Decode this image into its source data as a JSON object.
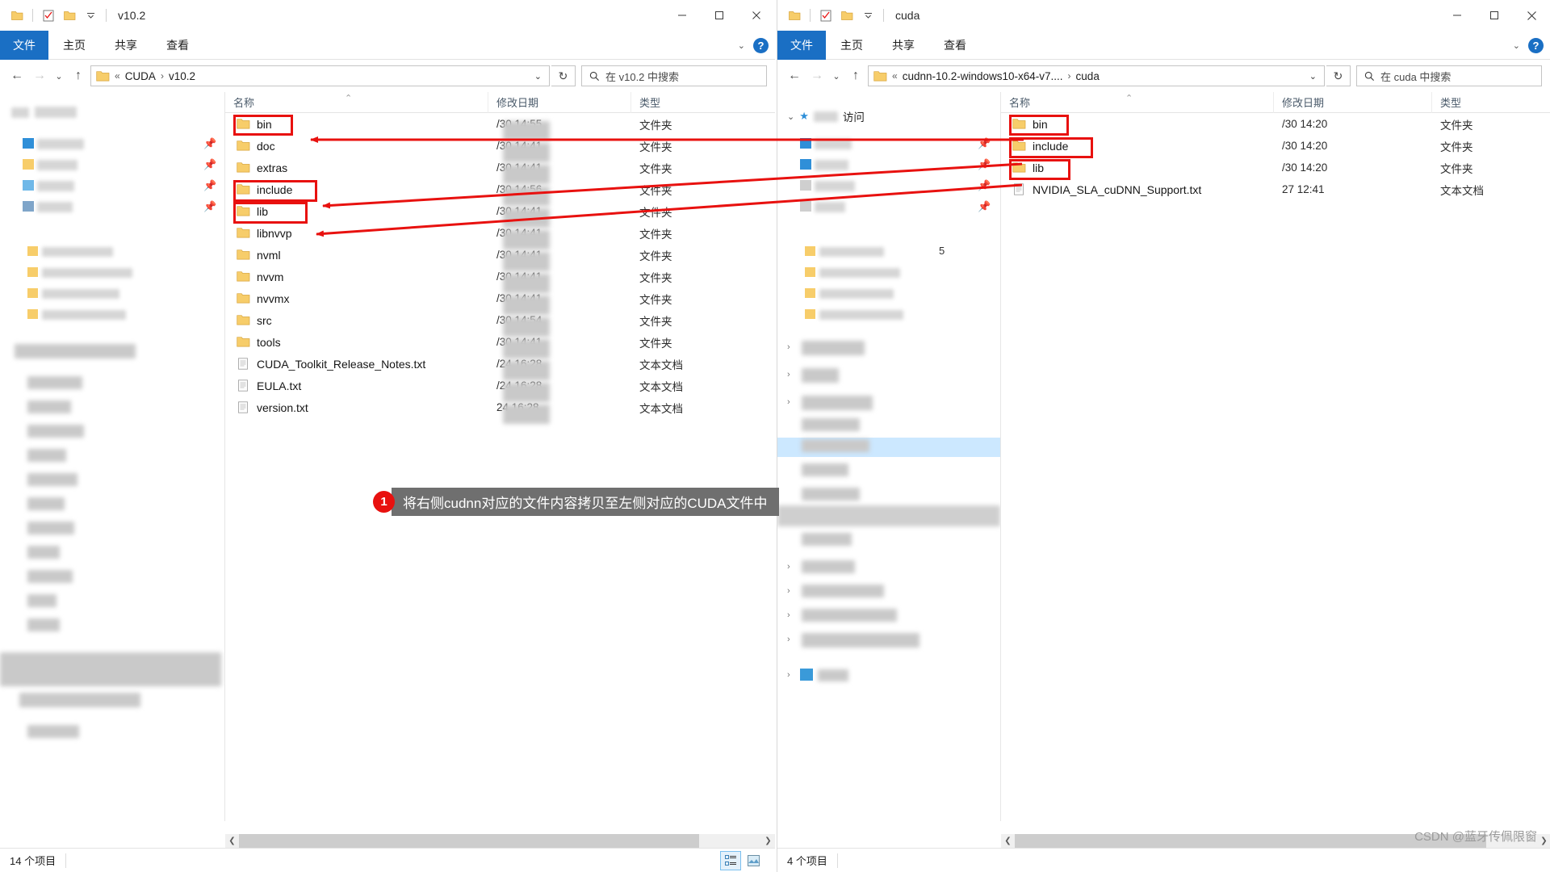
{
  "left_window": {
    "title": "v10.2",
    "qat_icons": [
      "folder-icon",
      "properties-icon",
      "new-folder-icon",
      "dropdown-caret-icon"
    ],
    "window_controls": [
      "minimize-icon",
      "maximize-icon",
      "close-icon"
    ],
    "ribbon": {
      "file_label": "文件",
      "tabs": [
        "主页",
        "共享",
        "查看"
      ],
      "help_label": "?"
    },
    "address": {
      "crumbs": [
        "«",
        "CUDA",
        "v10.2"
      ],
      "separator": "›",
      "refresh_label": "↻"
    },
    "search": {
      "placeholder": "在 v10.2 中搜索"
    },
    "columns": [
      "名称",
      "修改日期",
      "类型"
    ],
    "rows": [
      {
        "name": "bin",
        "icon": "folder-icon",
        "date": "/30 14:55",
        "type": "文件夹",
        "highlight": true
      },
      {
        "name": "doc",
        "icon": "folder-icon",
        "date": "/30 14:41",
        "type": "文件夹",
        "highlight": false
      },
      {
        "name": "extras",
        "icon": "folder-icon",
        "date": "/30 14:41",
        "type": "文件夹",
        "highlight": false
      },
      {
        "name": "include",
        "icon": "folder-icon",
        "date": "/30 14:56",
        "type": "文件夹",
        "highlight": true
      },
      {
        "name": "lib",
        "icon": "folder-icon",
        "date": "/30 14:41",
        "type": "文件夹",
        "highlight": true
      },
      {
        "name": "libnvvp",
        "icon": "folder-icon",
        "date": "/30 14:41",
        "type": "文件夹",
        "highlight": false
      },
      {
        "name": "nvml",
        "icon": "folder-icon",
        "date": "/30 14:41",
        "type": "文件夹",
        "highlight": false
      },
      {
        "name": "nvvm",
        "icon": "folder-icon",
        "date": "/30 14:41",
        "type": "文件夹",
        "highlight": false
      },
      {
        "name": "nvvmx",
        "icon": "folder-icon",
        "date": "/30 14:41",
        "type": "文件夹",
        "highlight": false
      },
      {
        "name": "src",
        "icon": "folder-icon",
        "date": "/30 14:54",
        "type": "文件夹",
        "highlight": false
      },
      {
        "name": "tools",
        "icon": "folder-icon",
        "date": "/30 14:41",
        "type": "文件夹",
        "highlight": false
      },
      {
        "name": "CUDA_Toolkit_Release_Notes.txt",
        "icon": "text-file-icon",
        "date": "/24 16:28",
        "type": "文本文档",
        "highlight": false
      },
      {
        "name": "EULA.txt",
        "icon": "text-file-icon",
        "date": "/24 16:28",
        "type": "文本文档",
        "highlight": false
      },
      {
        "name": "version.txt",
        "icon": "text-file-icon",
        "date": "24 16:28",
        "type": "文本文档",
        "highlight": false
      }
    ],
    "status": {
      "item_count": "14 个项目"
    }
  },
  "right_window": {
    "title": "cuda",
    "ribbon": {
      "file_label": "文件",
      "tabs": [
        "主页",
        "共享",
        "查看"
      ],
      "help_label": "?"
    },
    "address": {
      "crumbs": [
        "«",
        "cudnn-10.2-windows10-x64-v7....",
        "cuda"
      ],
      "separator": "›",
      "refresh_label": "↻"
    },
    "search": {
      "placeholder": "在 cuda 中搜索"
    },
    "nav_header": "访问",
    "columns": [
      "名称",
      "修改日期",
      "类型"
    ],
    "rows": [
      {
        "name": "bin",
        "icon": "folder-icon",
        "date": "/30 14:20",
        "type": "文件夹",
        "highlight": true
      },
      {
        "name": "include",
        "icon": "folder-icon",
        "date": "/30 14:20",
        "type": "文件夹",
        "highlight": true
      },
      {
        "name": "lib",
        "icon": "folder-icon",
        "date": "/30 14:20",
        "type": "文件夹",
        "highlight": true
      },
      {
        "name": "NVIDIA_SLA_cuDNN_Support.txt",
        "icon": "text-file-icon",
        "date": "27 12:41",
        "type": "文本文档",
        "highlight": false
      }
    ],
    "status": {
      "item_count": "4 个项目"
    }
  },
  "annotation": {
    "number": "1",
    "text": "将右侧cudnn对应的文件内容拷贝至左侧对应的CUDA文件中",
    "accent_color": "#e8110f",
    "banner_bg": "#6f6f6f"
  },
  "watermark": {
    "text": "CSDN @蓝牙传佩限窗"
  },
  "colors": {
    "ribbon_file_blue": "#1a6fc4",
    "highlight_red": "#e8110f",
    "folder_yellow": "#f7cd6a",
    "selection_blue": "#cce8ff"
  }
}
